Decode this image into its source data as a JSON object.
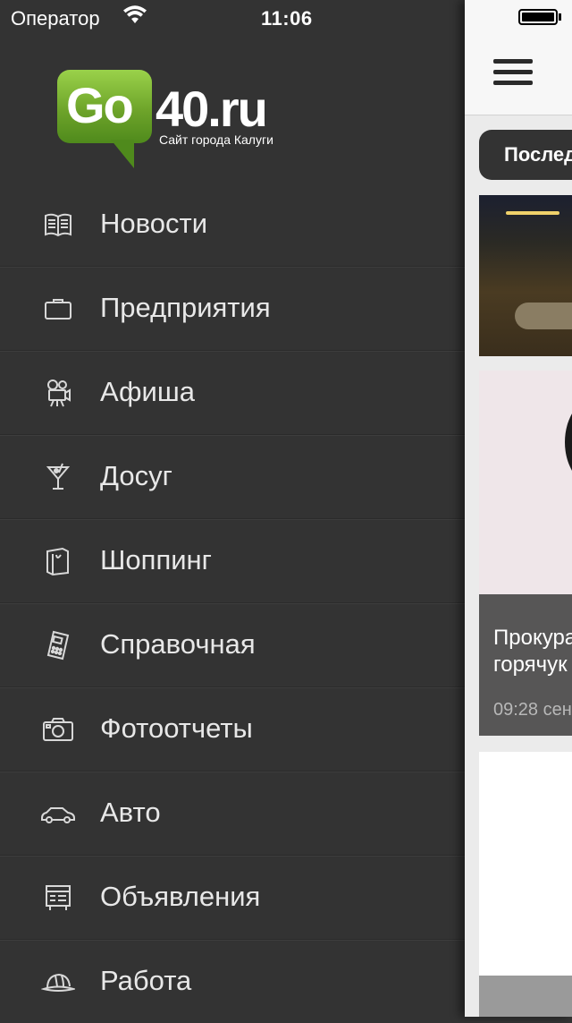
{
  "status_bar": {
    "carrier": "Оператор",
    "time": "11:06"
  },
  "logo": {
    "brand_go": "Go",
    "brand_domain": "40.ru",
    "tagline": "Сайт города Калуги",
    "colors": {
      "bubble": "#7ab535",
      "text": "#ffffff"
    }
  },
  "menu": {
    "items": [
      {
        "label": "Новости",
        "icon": "newspaper-icon"
      },
      {
        "label": "Предприятия",
        "icon": "briefcase-icon"
      },
      {
        "label": "Афиша",
        "icon": "movie-camera-icon"
      },
      {
        "label": "Досуг",
        "icon": "cocktail-icon"
      },
      {
        "label": "Шоппинг",
        "icon": "shopping-bag-icon"
      },
      {
        "label": "Справочная",
        "icon": "phone-icon"
      },
      {
        "label": "Фотоотчеты",
        "icon": "camera-icon"
      },
      {
        "label": "Авто",
        "icon": "car-icon"
      },
      {
        "label": "Объявления",
        "icon": "billboard-icon"
      },
      {
        "label": "Работа",
        "icon": "hard-hat-icon"
      }
    ]
  },
  "content": {
    "tab_label": "Послед",
    "card_title": "Прокура\nгорячук",
    "card_time": "09:28 сен"
  },
  "colors": {
    "menu_background": "#333333",
    "menu_text": "#e8e8e8",
    "content_background": "#ebebeb"
  }
}
